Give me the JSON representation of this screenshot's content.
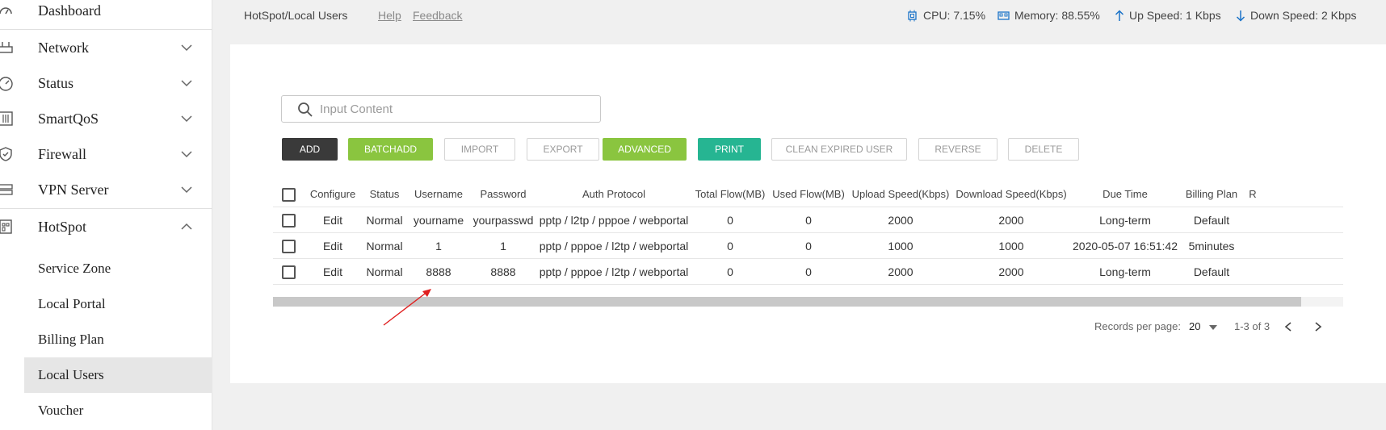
{
  "sidebar": {
    "items": [
      {
        "label": "Dashboard",
        "icon": "dashboard-icon"
      },
      {
        "label": "Network",
        "icon": "network-icon"
      },
      {
        "label": "Status",
        "icon": "status-gauge-icon"
      },
      {
        "label": "SmartQoS",
        "icon": "sliders-icon"
      },
      {
        "label": "Firewall",
        "icon": "shield-icon"
      },
      {
        "label": "VPN Server",
        "icon": "vpn-icon"
      },
      {
        "label": "HotSpot",
        "icon": "hotspot-icon"
      }
    ],
    "hotspot_subitems": [
      "Service Zone",
      "Local Portal",
      "Billing Plan",
      "Local Users",
      "Voucher"
    ],
    "active_subitem": "Local Users"
  },
  "header": {
    "breadcrumb": "HotSpot/Local Users",
    "help": "Help",
    "feedback": "Feedback",
    "cpu": "CPU: 7.15%",
    "memory": "Memory: 88.55%",
    "up_speed": "Up Speed: 1 Kbps",
    "down_speed": "Down Speed: 2 Kbps"
  },
  "search": {
    "placeholder": "Input Content",
    "value": ""
  },
  "toolbar": {
    "add": "ADD",
    "batchadd": "BATCHADD",
    "import": "IMPORT",
    "export": "EXPORT",
    "advanced": "ADVANCED",
    "print": "PRINT",
    "clean_expired": "CLEAN EXPIRED USER",
    "reverse": "REVERSE",
    "delete": "DELETE"
  },
  "table": {
    "columns": [
      "Configure",
      "Status",
      "Username",
      "Password",
      "Auth Protocol",
      "Total Flow(MB)",
      "Used Flow(MB)",
      "Upload Speed(Kbps)",
      "Download Speed(Kbps)",
      "Due Time",
      "Billing Plan",
      "R"
    ],
    "rows": [
      {
        "configure": "Edit",
        "status": "Normal",
        "username": "yourname",
        "password": "yourpasswd",
        "auth": "pptp / l2tp / pppoe / webportal",
        "total": "0",
        "used": "0",
        "upload": "2000",
        "download": "2000",
        "due": "Long-term",
        "plan": "Default"
      },
      {
        "configure": "Edit",
        "status": "Normal",
        "username": "1",
        "password": "1",
        "auth": "pptp / pppoe / l2tp / webportal",
        "total": "0",
        "used": "0",
        "upload": "1000",
        "download": "1000",
        "due": "2020-05-07 16:51:42",
        "plan": "5minutes"
      },
      {
        "configure": "Edit",
        "status": "Normal",
        "username": "8888",
        "password": "8888",
        "auth": "pptp / pppoe / l2tp / webportal",
        "total": "0",
        "used": "0",
        "upload": "2000",
        "download": "2000",
        "due": "Long-term",
        "plan": "Default"
      }
    ]
  },
  "pagination": {
    "label": "Records per page:",
    "per_page": "20",
    "range": "1-3 of 3"
  },
  "colors": {
    "dark_button": "#3a3a3a",
    "green_button": "#8ac53f",
    "teal_button": "#26b592",
    "accent_blue": "#1a73c8",
    "annotation_arrow": "#e02020"
  }
}
